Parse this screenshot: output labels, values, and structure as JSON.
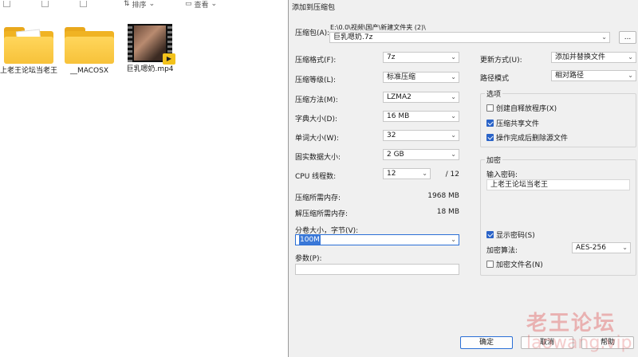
{
  "explorer": {
    "toolbar": {
      "sort_label": "排序",
      "view_label": "查看"
    },
    "files": [
      {
        "name": "上老王论坛当老王",
        "type": "folder"
      },
      {
        "name": "__MACOSX",
        "type": "folder"
      },
      {
        "name": "巨乳嗯奶.mp4",
        "type": "video"
      }
    ]
  },
  "dialog": {
    "title": "添加到压缩包",
    "archive_label": "压缩包(A):",
    "archive_path": "E:\\0.0\\视频\\国产\\新建文件夹 (2)\\",
    "archive_name": "巨乳嗯奶.7z",
    "browse_label": "...",
    "format_label": "压缩格式(F):",
    "format_value": "7z",
    "level_label": "压缩等级(L):",
    "level_value": "标准压缩",
    "method_label": "压缩方法(M):",
    "method_value": "LZMA2",
    "dict_label": "字典大小(D):",
    "dict_value": "16 MB",
    "word_label": "单词大小(W):",
    "word_value": "32",
    "solid_label": "固实数据大小:",
    "solid_value": "2 GB",
    "threads_label": "CPU 线程数:",
    "threads_value": "12",
    "threads_total": "/ 12",
    "mem_comp_label": "压缩所需内存:",
    "mem_comp_value": "1968 MB",
    "mem_decomp_label": "解压缩所需内存:",
    "mem_decomp_value": "18 MB",
    "split_label": "分卷大小，字节(V):",
    "split_value": "100M",
    "params_label": "参数(P):",
    "params_value": "",
    "update_label": "更新方式(U):",
    "update_value": "添加并替换文件",
    "path_mode_label": "路径模式",
    "path_mode_value": "相对路径",
    "options_group": "选项",
    "opt_sfx": "创建自释放程序(X)",
    "opt_shared": "压缩共享文件",
    "opt_delete": "操作完成后删除源文件",
    "encrypt_group": "加密",
    "password_label": "输入密码:",
    "password_value": "上老王论坛当老王",
    "show_password": "显示密码(S)",
    "enc_method_label": "加密算法:",
    "enc_method_value": "AES-256",
    "encrypt_names": "加密文件名(N)",
    "ok_label": "确定",
    "cancel_label": "取消",
    "help_label": "帮助"
  },
  "watermark": {
    "text": "老王论坛",
    "text2": "laowang.vip"
  },
  "colors": {
    "accent": "#2a63c8",
    "focus": "#2a6fd6",
    "folder": "#f7c23a",
    "dialog_bg": "#f0f0f0"
  }
}
